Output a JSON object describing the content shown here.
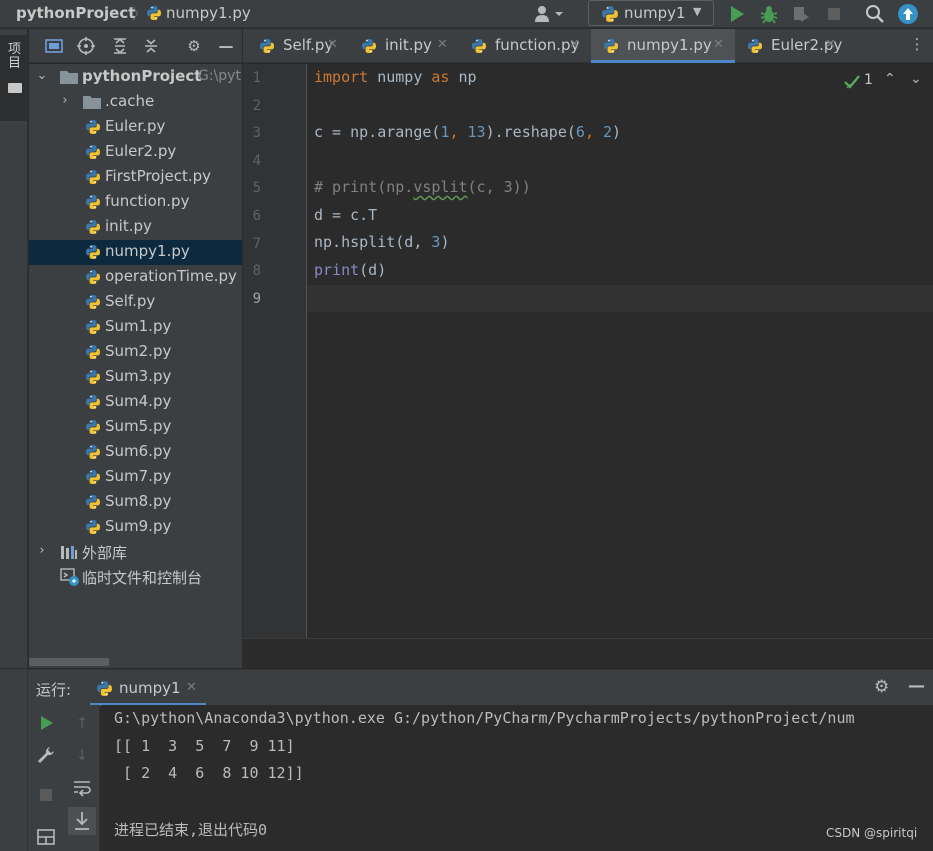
{
  "navbar": {
    "project": "pythonProject",
    "file": "numpy1.py",
    "run_config": "numpy1"
  },
  "side_strip": {
    "project_tab": "项目"
  },
  "project_tree": {
    "root": {
      "name": "pythonProject",
      "path": "G:\\pyt"
    },
    "items": [
      {
        "label": ".cache",
        "type": "folder"
      },
      {
        "label": "Euler.py",
        "type": "py"
      },
      {
        "label": "Euler2.py",
        "type": "py"
      },
      {
        "label": "FirstProject.py",
        "type": "py"
      },
      {
        "label": "function.py",
        "type": "py"
      },
      {
        "label": "init.py",
        "type": "py"
      },
      {
        "label": "numpy1.py",
        "type": "py",
        "selected": true
      },
      {
        "label": "operationTime.py",
        "type": "py"
      },
      {
        "label": "Self.py",
        "type": "py"
      },
      {
        "label": "Sum1.py",
        "type": "py"
      },
      {
        "label": "Sum2.py",
        "type": "py"
      },
      {
        "label": "Sum3.py",
        "type": "py"
      },
      {
        "label": "Sum4.py",
        "type": "py"
      },
      {
        "label": "Sum5.py",
        "type": "py"
      },
      {
        "label": "Sum6.py",
        "type": "py"
      },
      {
        "label": "Sum7.py",
        "type": "py"
      },
      {
        "label": "Sum8.py",
        "type": "py"
      },
      {
        "label": "Sum9.py",
        "type": "py"
      }
    ],
    "external_libs": "外部库",
    "scratches": "临时文件和控制台"
  },
  "editor": {
    "tabs": [
      {
        "label": "Self.py"
      },
      {
        "label": "init.py"
      },
      {
        "label": "function.py"
      },
      {
        "label": "numpy1.py",
        "active": true
      },
      {
        "label": "Euler2.py"
      }
    ],
    "line_numbers": [
      "1",
      "2",
      "3",
      "4",
      "5",
      "6",
      "7",
      "8",
      "9"
    ],
    "code": {
      "l1_kw1": "import",
      "l1_mod": " numpy ",
      "l1_kw2": "as",
      "l1_alias": " np",
      "l3_a": "c = np.arange(",
      "l3_n1": "1",
      "l3_b": ", ",
      "l3_n2": "13",
      "l3_c": ").reshape(",
      "l3_n3": "6",
      "l3_d": ", ",
      "l3_n4": "2",
      "l3_e": ")",
      "l5_a": "# print(np.",
      "l5_b": "vsplit",
      "l5_c": "(c, 3))",
      "l6": "d = c.T",
      "l7_a": "np.hsplit(d, ",
      "l7_n": "3",
      "l7_b": ")",
      "l8_fn": "print",
      "l8_rest": "(d)"
    },
    "inspection_count": "1"
  },
  "run_window": {
    "title": "运行:",
    "tab": "numpy1",
    "console": [
      "G:\\python\\Anaconda3\\python.exe G:/python/PyCharm/PycharmProjects/pythonProject/num",
      "[[ 1  3  5  7  9 11]",
      " [ 2  4  6  8 10 12]]",
      "",
      "进程已结束,退出代码0"
    ]
  },
  "watermark": "CSDN @spiritqi",
  "colors": {
    "accent": "#4a88c7",
    "run_green": "#499c54",
    "keyword": "#cc7832",
    "number": "#6897bb",
    "comment": "#808080",
    "builtin": "#8888c6"
  }
}
